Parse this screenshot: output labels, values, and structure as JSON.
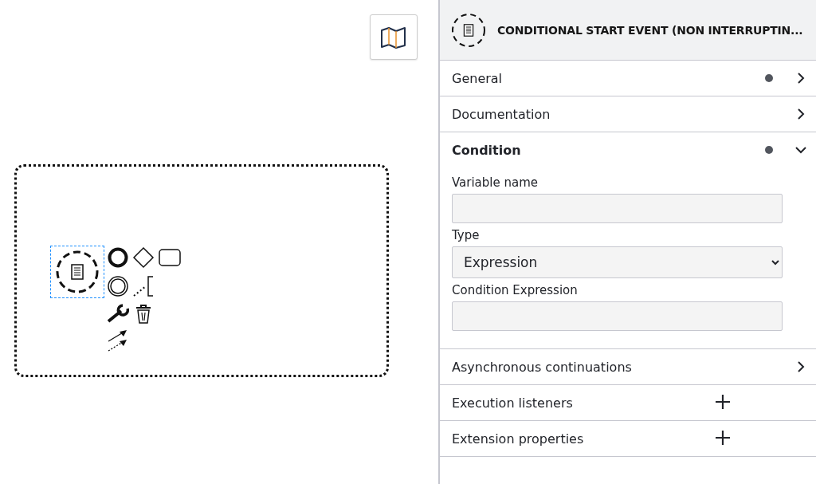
{
  "canvas": {
    "selected_event": true
  },
  "panel": {
    "title": "CONDITIONAL START EVENT (NON INTERRUPTIN...",
    "groups": [
      {
        "kind": "collapsible",
        "label": "General",
        "has_value": true,
        "expanded": false
      },
      {
        "kind": "collapsible",
        "label": "Documentation",
        "has_value": false,
        "expanded": false
      },
      {
        "kind": "collapsible",
        "label": "Condition",
        "has_value": true,
        "expanded": true,
        "fields": [
          {
            "kind": "text",
            "label": "Variable name"
          },
          {
            "kind": "select",
            "label": "Type",
            "value": "Expression"
          },
          {
            "kind": "text",
            "label": "Condition Expression"
          }
        ]
      },
      {
        "kind": "collapsible",
        "label": "Asynchronous continuations",
        "has_value": false,
        "expanded": false
      },
      {
        "kind": "list",
        "label": "Execution listeners"
      },
      {
        "kind": "list",
        "label": "Extension properties"
      }
    ]
  }
}
